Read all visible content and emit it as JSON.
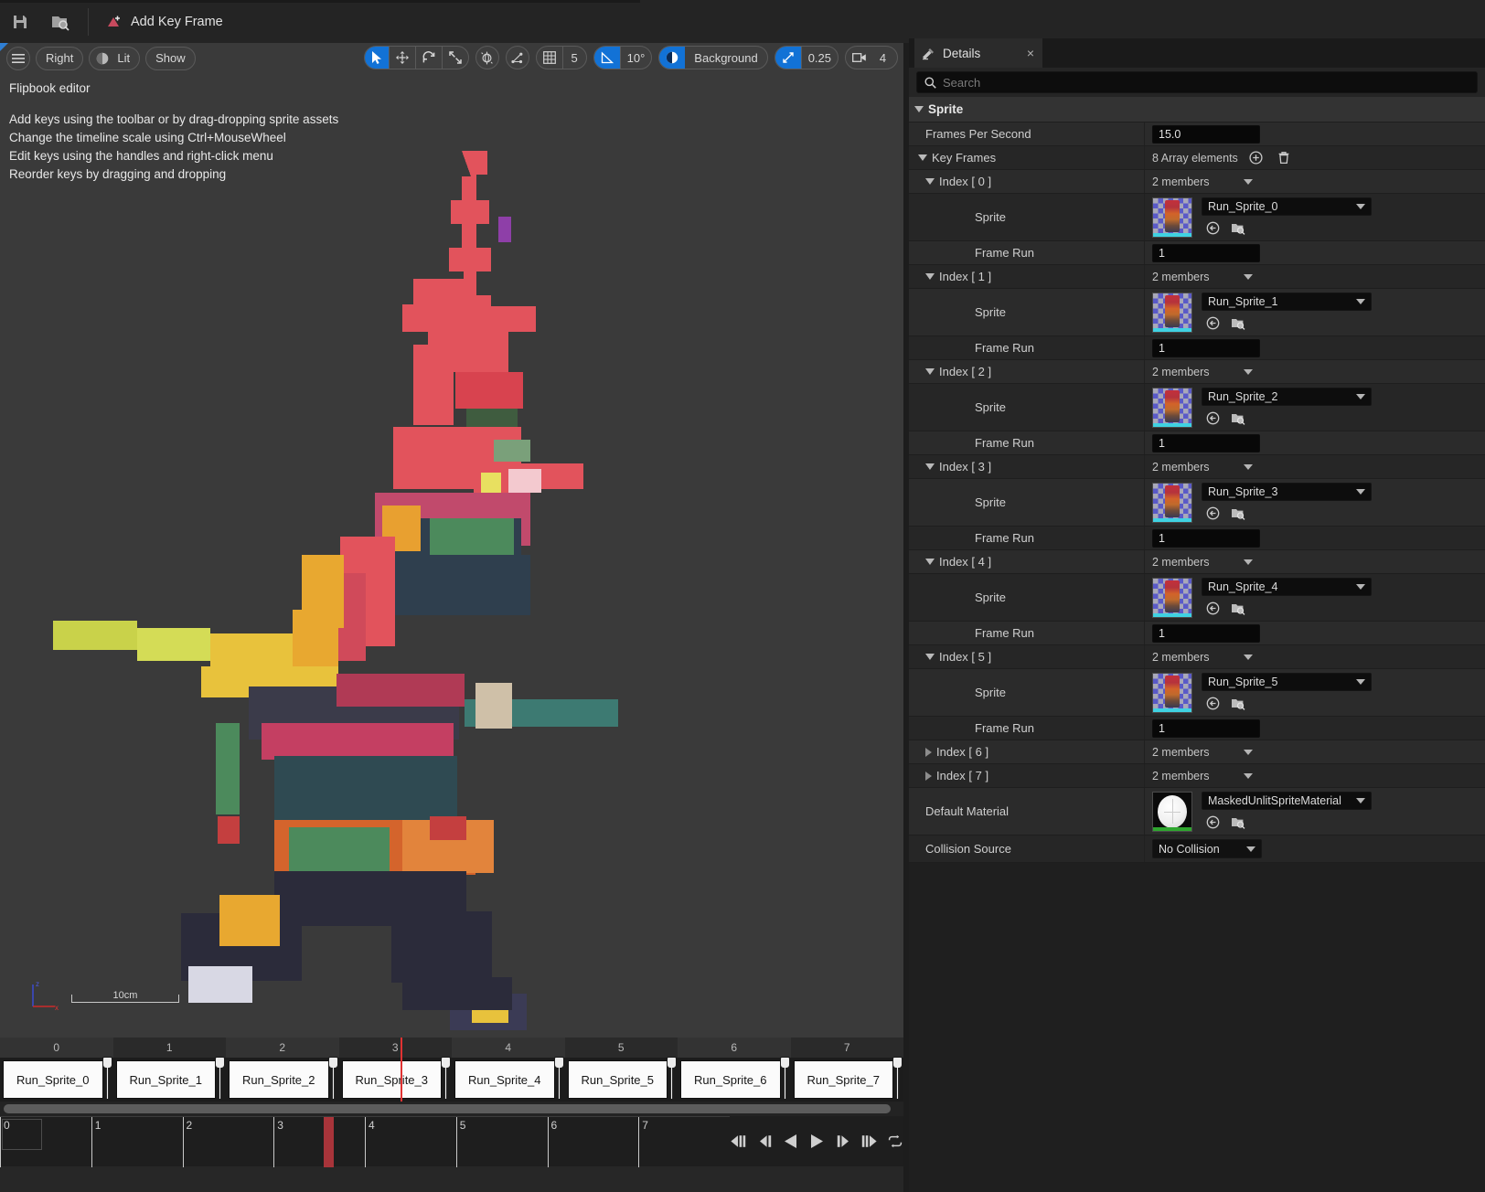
{
  "toolbar": {
    "save_tooltip": "Save",
    "browse_tooltip": "Browse",
    "add_key_frame_label": "Add Key Frame"
  },
  "viewport": {
    "menu_label": "☰",
    "view_label": "Right",
    "lit_label": "Lit",
    "show_label": "Show",
    "grid_snap_value": "5",
    "angle_snap_value": "10°",
    "background_label": "Background",
    "scale_snap_value": "0.25",
    "camera_speed_value": "4",
    "overlay_title": "Flipbook editor",
    "overlay_lines": [
      "Add keys using the toolbar or by drag-dropping sprite assets",
      "Change the timeline scale using Ctrl+MouseWheel",
      "Edit keys using the handles and right-click menu",
      "Reorder keys by dragging and dropping"
    ],
    "scale_label": "10cm",
    "axis_x": "x",
    "axis_z": "z"
  },
  "details": {
    "tab_label": "Details",
    "close_label": "×",
    "search_placeholder": "Search",
    "search_value": "",
    "category": "Sprite",
    "fps_label": "Frames Per Second",
    "fps_value": "15.0",
    "key_frames_label": "Key Frames",
    "key_frames_count": "8 Array elements",
    "members_label": "2 members",
    "sprite_label": "Sprite",
    "frame_run_label": "Frame Run",
    "indices": [
      {
        "label": "Index [ 0 ]",
        "expanded": true,
        "sprite": "Run_Sprite_0",
        "frame_run": "1"
      },
      {
        "label": "Index [ 1 ]",
        "expanded": true,
        "sprite": "Run_Sprite_1",
        "frame_run": "1"
      },
      {
        "label": "Index [ 2 ]",
        "expanded": true,
        "sprite": "Run_Sprite_2",
        "frame_run": "1"
      },
      {
        "label": "Index [ 3 ]",
        "expanded": true,
        "sprite": "Run_Sprite_3",
        "frame_run": "1"
      },
      {
        "label": "Index [ 4 ]",
        "expanded": true,
        "sprite": "Run_Sprite_4",
        "frame_run": "1"
      },
      {
        "label": "Index [ 5 ]",
        "expanded": true,
        "sprite": "Run_Sprite_5",
        "frame_run": "1"
      },
      {
        "label": "Index [ 6 ]",
        "expanded": false
      },
      {
        "label": "Index [ 7 ]",
        "expanded": false
      }
    ],
    "default_material_label": "Default Material",
    "default_material_value": "MaskedUnlitSpriteMaterial",
    "collision_source_label": "Collision Source",
    "collision_source_value": "No Collision"
  },
  "timeline": {
    "ruler_ticks": [
      "0",
      "1",
      "2",
      "3",
      "4",
      "5",
      "6",
      "7"
    ],
    "keys": [
      "Run_Sprite_0",
      "Run_Sprite_1",
      "Run_Sprite_2",
      "Run_Sprite_3",
      "Run_Sprite_4",
      "Run_Sprite_5",
      "Run_Sprite_6",
      "Run_Sprite_7"
    ],
    "frame_ticks": [
      "0",
      "1",
      "2",
      "3",
      "4",
      "5",
      "6",
      "7"
    ],
    "playhead_frame": 3.55,
    "transport": [
      "skip-to-start",
      "step-back",
      "play-reverse",
      "play",
      "step-forward",
      "skip-to-end",
      "loop"
    ]
  },
  "colors": {
    "accent_blue": "#1272d6",
    "playhead_red": "#e03232",
    "panel_bg": "#242424",
    "viewport_bg": "#3a3a3a"
  }
}
